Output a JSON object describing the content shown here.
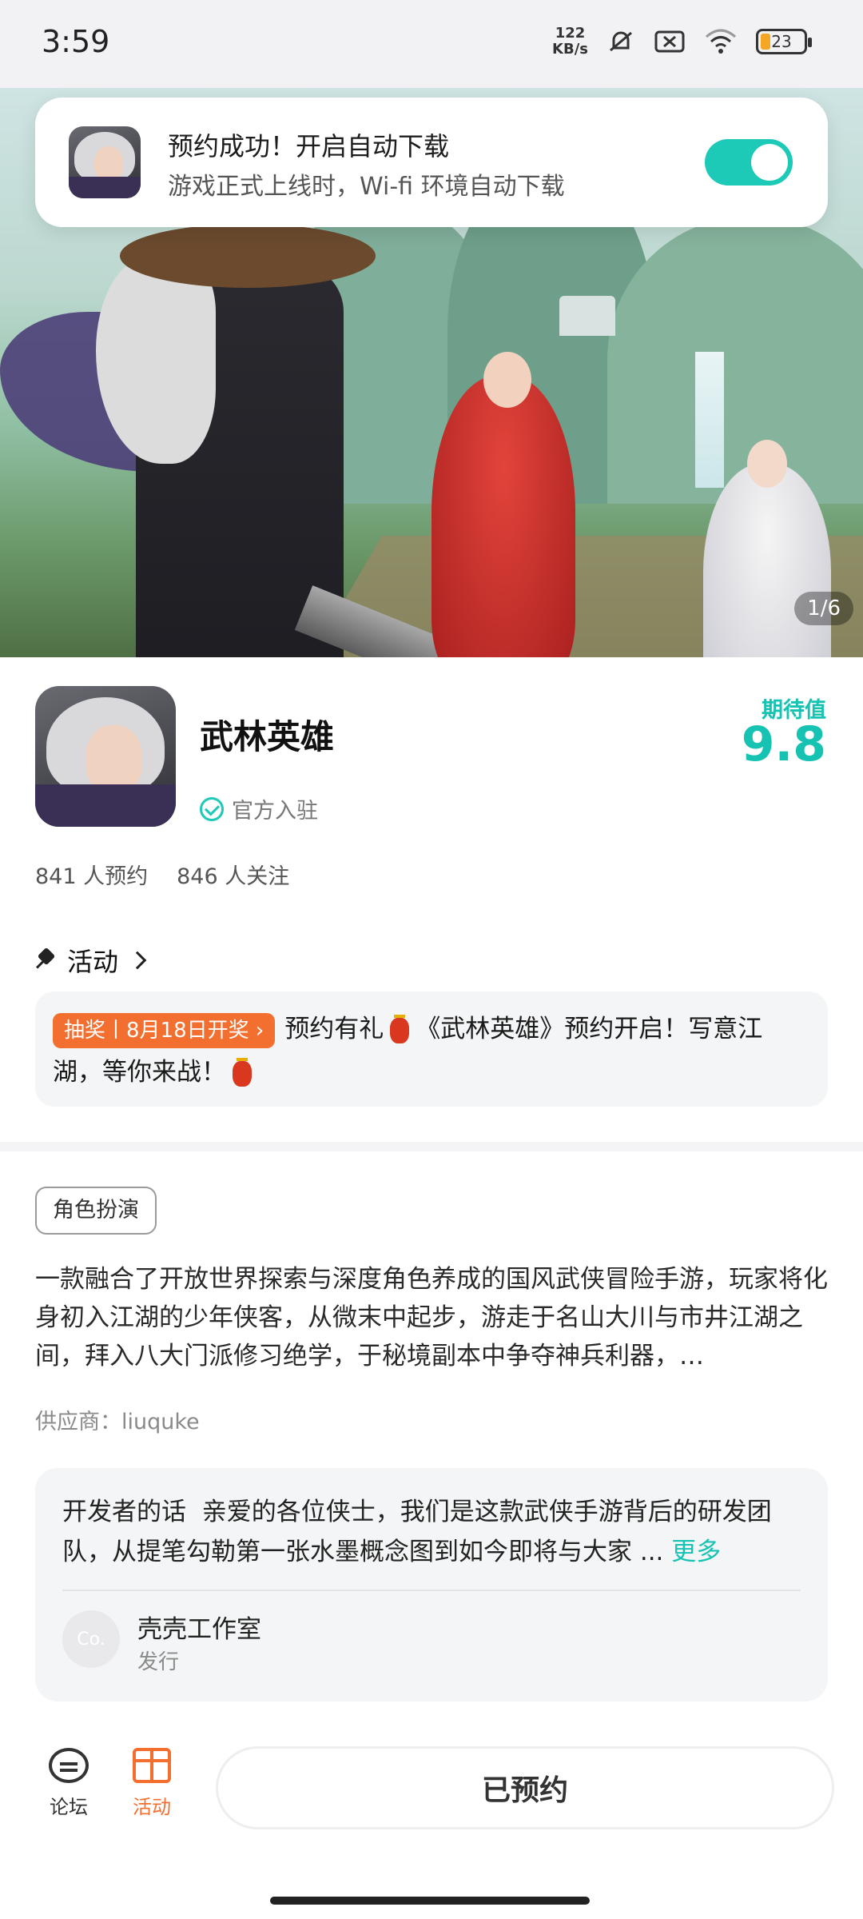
{
  "status_bar": {
    "time": "3:59",
    "net_speed_value": "122",
    "net_speed_unit": "KB/s",
    "battery": "23"
  },
  "toast": {
    "title": "预约成功！开启自动下载",
    "subtitle": "游戏正式上线时，Wi-fi 环境自动下载",
    "toggle_on": true
  },
  "banner": {
    "counter": "1/6"
  },
  "game": {
    "title": "武林英雄",
    "official_label": "官方入驻",
    "expect_label": "期待值",
    "expect_value": "9.8",
    "reservations": "841 人预约",
    "followers": "846 人关注"
  },
  "activity": {
    "header": "活动",
    "badge": "抽奖丨8月18日开奖",
    "text_part1": "预约有礼",
    "text_part2": "《武林英雄》预约开启！写意江湖，等你来战！"
  },
  "description": {
    "tag": "角色扮演",
    "text": "一款融合了开放世界探索与深度角色养成的国风武侠冒险手游，玩家将化身初入江湖的少年侠客，从微末中起步，游走于名山大川与市井江湖之间，拜入八大门派修习绝学，于秘境副本中争夺神兵利器，…",
    "supplier": "供应商：liuquke"
  },
  "developer": {
    "label": "开发者的话",
    "text": "亲爱的各位侠士，我们是这款武侠手游背后的研发团队，从提笔勾勒第一张水墨概念图到如今即将与大家 ...",
    "more": "更多",
    "avatar_text": "Co.",
    "name": "壳壳工作室",
    "role": "发行"
  },
  "bottom_bar": {
    "forum": "论坛",
    "activity": "活动",
    "reserved_button": "已预约"
  },
  "colors": {
    "accent": "#16c3b3",
    "orange": "#f36f2f"
  }
}
